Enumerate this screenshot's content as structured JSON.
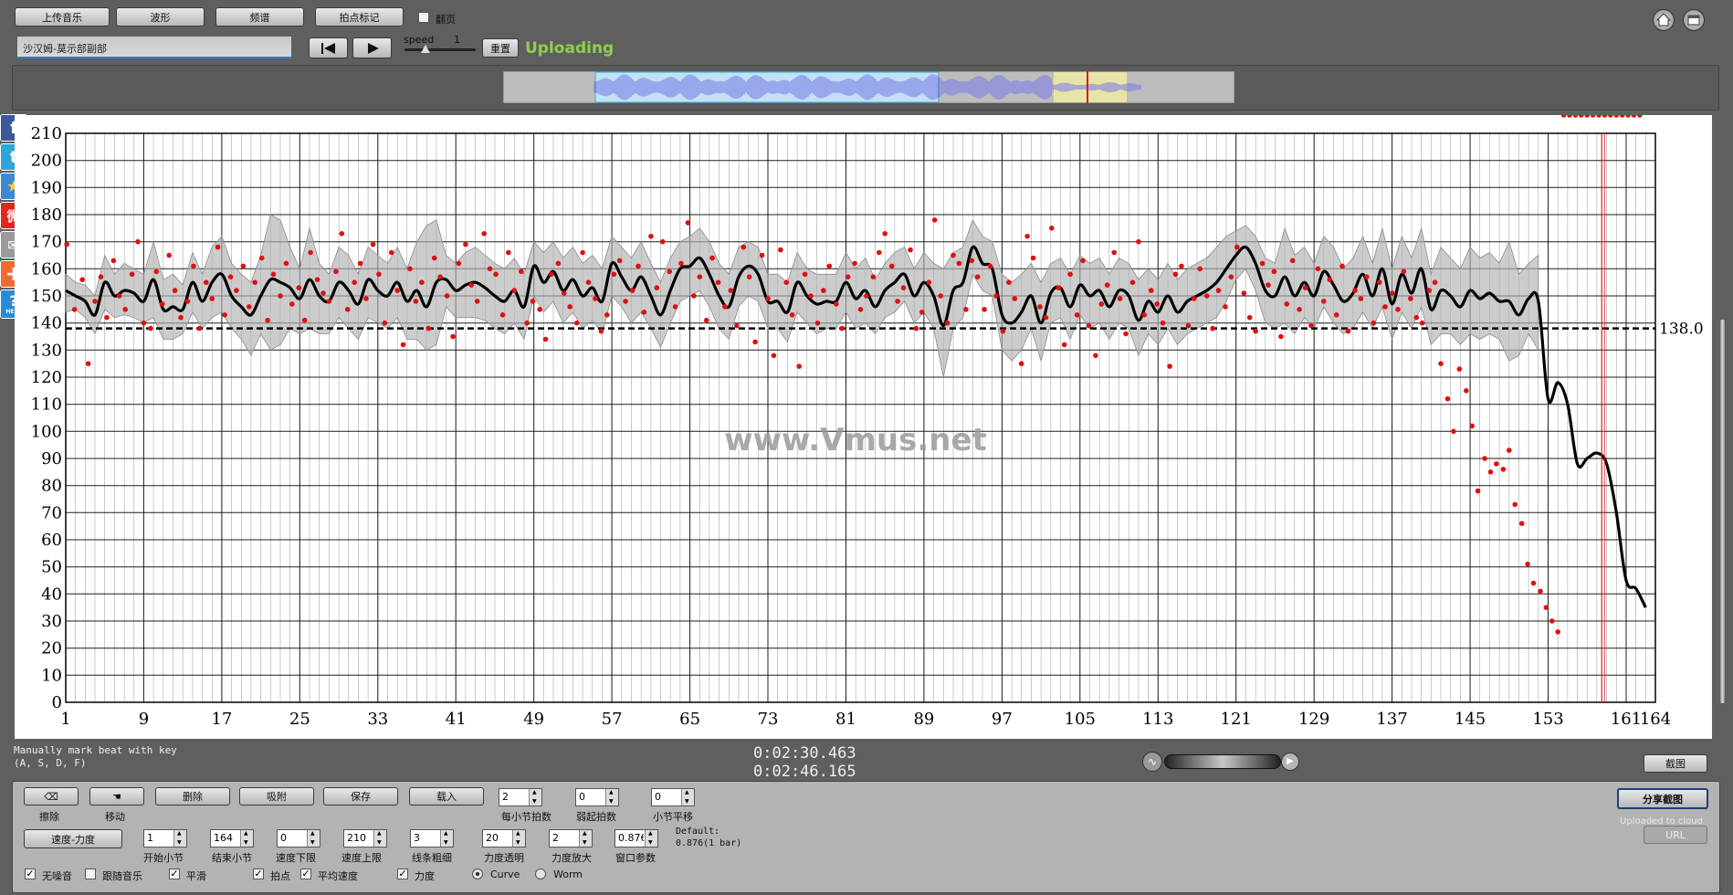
{
  "toolbar": {
    "upload_label": "上传音乐",
    "waveform_label": "波形",
    "spectrum_label": "频谱",
    "beat_label": "拍点标记",
    "flip_label": "翻页",
    "song_title": "沙汉姆-莫示部副部",
    "speed_label": "speed",
    "speed_value": "1",
    "reset_label": "重置",
    "status": "Uploading",
    "status_color": "#8ed04a"
  },
  "icons": [
    "home-icon",
    "window-icon",
    "prev-icon",
    "play-icon",
    "facebook-icon",
    "twitter-icon",
    "star-icon",
    "weibo-icon",
    "mail-icon",
    "plus-icon",
    "help-icon"
  ],
  "social": {
    "help_label": "HELP"
  },
  "watermark": "www.Vmus.net",
  "chart_data": {
    "type": "line",
    "ylim": [
      0,
      210
    ],
    "yticks": [
      0,
      10,
      20,
      30,
      40,
      50,
      60,
      70,
      80,
      90,
      100,
      110,
      120,
      130,
      140,
      150,
      160,
      170,
      180,
      190,
      200,
      210
    ],
    "xlim": [
      1,
      164
    ],
    "xticks": [
      1,
      9,
      17,
      25,
      33,
      41,
      49,
      57,
      65,
      73,
      81,
      89,
      97,
      105,
      113,
      121,
      129,
      137,
      145,
      153,
      161,
      164
    ],
    "reference_line": {
      "value": 138.0,
      "label": "138.0"
    },
    "cursor_bar": 158.5,
    "colors": {
      "smooth_curve": "#000000",
      "beats": "#e01010",
      "band": "#b0b0b0",
      "cursor": "#e02020"
    },
    "smooth_curve": {
      "x": [
        1,
        2,
        3,
        4,
        5,
        6,
        7,
        8,
        9,
        10,
        11,
        12,
        13,
        14,
        15,
        16,
        17,
        18,
        19,
        20,
        21,
        22,
        23,
        24,
        25,
        26,
        27,
        28,
        29,
        30,
        31,
        32,
        33,
        34,
        35,
        36,
        37,
        38,
        39,
        40,
        41,
        42,
        43,
        44,
        45,
        46,
        47,
        48,
        49,
        50,
        51,
        52,
        53,
        54,
        55,
        56,
        57,
        58,
        59,
        60,
        61,
        62,
        63,
        64,
        65,
        66,
        67,
        68,
        69,
        70,
        71,
        72,
        73,
        74,
        75,
        76,
        77,
        78,
        79,
        80,
        81,
        82,
        83,
        84,
        85,
        86,
        87,
        88,
        89,
        90,
        91,
        92,
        93,
        94,
        95,
        96,
        97,
        98,
        99,
        100,
        101,
        102,
        103,
        104,
        105,
        106,
        107,
        108,
        109,
        110,
        111,
        112,
        113,
        114,
        115,
        116,
        117,
        118,
        119,
        120,
        121,
        122,
        123,
        124,
        125,
        126,
        127,
        128,
        129,
        130,
        131,
        132,
        133,
        134,
        135,
        136,
        137,
        138,
        139,
        140,
        141,
        142,
        143,
        144,
        145,
        146,
        147,
        148,
        149,
        150,
        151,
        152,
        153,
        154,
        155,
        156,
        157,
        158,
        159,
        160,
        161,
        162,
        163
      ],
      "y": [
        152,
        150,
        148,
        143,
        155,
        150,
        152,
        151,
        148,
        156,
        145,
        146,
        145,
        155,
        148,
        155,
        158,
        150,
        146,
        143,
        150,
        156,
        155,
        153,
        149,
        156,
        150,
        148,
        155,
        152,
        147,
        156,
        152,
        150,
        155,
        148,
        152,
        146,
        155,
        156,
        152,
        154,
        155,
        153,
        150,
        148,
        152,
        146,
        161,
        155,
        159,
        152,
        156,
        150,
        153,
        148,
        162,
        157,
        152,
        157,
        150,
        143,
        152,
        160,
        161,
        164,
        158,
        150,
        146,
        157,
        161,
        158,
        148,
        148,
        144,
        155,
        150,
        147,
        148,
        148,
        155,
        149,
        152,
        146,
        152,
        155,
        158,
        150,
        155,
        150,
        139,
        152,
        155,
        168,
        162,
        160,
        143,
        140,
        144,
        150,
        140,
        151,
        153,
        146,
        154,
        150,
        152,
        146,
        152,
        150,
        141,
        148,
        144,
        150,
        144,
        148,
        150,
        152,
        155,
        160,
        165,
        168,
        162,
        152,
        150,
        157,
        150,
        155,
        150,
        159,
        154,
        148,
        151,
        158,
        150,
        160,
        147,
        158,
        151,
        160,
        145,
        152,
        150,
        146,
        152,
        149,
        151,
        148,
        148,
        143,
        149,
        148,
        112,
        118,
        110,
        88,
        90,
        92,
        88,
        70,
        45,
        42,
        35,
        25
      ]
    },
    "band": {
      "upper": [
        158,
        155,
        154,
        150,
        165,
        158,
        162,
        160,
        158,
        170,
        156,
        158,
        154,
        166,
        158,
        168,
        172,
        162,
        158,
        155,
        165,
        180,
        178,
        168,
        160,
        175,
        162,
        158,
        168,
        165,
        158,
        168,
        165,
        162,
        168,
        160,
        170,
        176,
        178,
        165,
        162,
        166,
        168,
        165,
        162,
        160,
        164,
        158,
        170,
        166,
        170,
        164,
        168,
        162,
        165,
        160,
        172,
        168,
        164,
        170,
        162,
        155,
        164,
        170,
        172,
        175,
        170,
        162,
        158,
        168,
        170,
        168,
        158,
        158,
        155,
        166,
        160,
        158,
        158,
        158,
        166,
        160,
        164,
        156,
        162,
        166,
        168,
        160,
        166,
        162,
        160,
        166,
        168,
        178,
        172,
        170,
        158,
        155,
        158,
        162,
        155,
        162,
        164,
        158,
        165,
        162,
        164,
        158,
        164,
        162,
        156,
        160,
        156,
        162,
        156,
        160,
        162,
        164,
        168,
        172,
        174,
        176,
        172,
        164,
        162,
        175,
        165,
        168,
        162,
        172,
        168,
        160,
        164,
        172,
        162,
        175,
        160,
        172,
        164,
        175,
        158,
        168,
        164,
        160,
        168,
        164,
        166,
        162,
        170,
        158,
        162,
        165
      ],
      "lower": [
        144,
        145,
        142,
        136,
        145,
        142,
        143,
        142,
        140,
        142,
        134,
        134,
        136,
        144,
        138,
        142,
        144,
        138,
        134,
        128,
        136,
        130,
        132,
        138,
        136,
        138,
        136,
        136,
        142,
        138,
        134,
        142,
        140,
        138,
        142,
        134,
        134,
        130,
        132,
        146,
        142,
        142,
        142,
        141,
        138,
        136,
        140,
        134,
        150,
        144,
        148,
        140,
        144,
        138,
        141,
        136,
        150,
        146,
        140,
        144,
        138,
        131,
        140,
        148,
        150,
        152,
        146,
        138,
        134,
        146,
        150,
        148,
        138,
        138,
        133,
        144,
        140,
        136,
        138,
        138,
        144,
        138,
        140,
        136,
        142,
        144,
        148,
        140,
        144,
        138,
        120,
        138,
        142,
        158,
        152,
        150,
        130,
        126,
        130,
        138,
        126,
        140,
        142,
        134,
        143,
        138,
        140,
        134,
        140,
        138,
        128,
        136,
        132,
        138,
        132,
        136,
        138,
        140,
        142,
        148,
        156,
        160,
        152,
        140,
        138,
        140,
        136,
        142,
        138,
        146,
        140,
        136,
        138,
        144,
        138,
        146,
        134,
        144,
        138,
        146,
        132,
        136,
        136,
        132,
        136,
        134,
        136,
        134,
        126,
        128,
        136,
        130
      ]
    },
    "beats": {
      "x": [
        1.1,
        1.9,
        2.7,
        3.3,
        4,
        4.6,
        5.2,
        5.9,
        6.5,
        7.1,
        7.8,
        8.4,
        9,
        9.7,
        10.3,
        10.9,
        11.6,
        12.2,
        12.8,
        13.5,
        14.1,
        14.7,
        15.4,
        16,
        16.6,
        17.3,
        17.9,
        18.5,
        19.2,
        19.8,
        20.4,
        21.1,
        21.7,
        22.3,
        23,
        23.6,
        24.2,
        24.9,
        25.5,
        26.1,
        26.8,
        27.4,
        28,
        28.7,
        29.3,
        29.9,
        30.6,
        31.2,
        31.8,
        32.5,
        33.1,
        33.7,
        34.4,
        35,
        35.6,
        36.3,
        36.9,
        37.5,
        38.2,
        38.8,
        39.4,
        40.1,
        40.7,
        41.3,
        42,
        42.6,
        43.2,
        43.9,
        44.5,
        45.1,
        45.8,
        46.4,
        47,
        47.7,
        48.3,
        48.9,
        49.6,
        50.2,
        50.8,
        51.5,
        52.1,
        52.7,
        53.4,
        54,
        54.6,
        55.3,
        55.9,
        56.5,
        57.2,
        57.8,
        58.4,
        59.1,
        59.7,
        60.3,
        61,
        61.6,
        62.2,
        62.9,
        63.5,
        64.1,
        64.8,
        65.4,
        66,
        66.7,
        67.3,
        67.9,
        68.6,
        69.2,
        69.8,
        70.5,
        71.1,
        71.7,
        72.4,
        73,
        73.6,
        74.3,
        74.9,
        75.5,
        76.2,
        76.8,
        77.4,
        78.1,
        78.7,
        79.3,
        80,
        80.6,
        81.2,
        81.9,
        82.5,
        83.1,
        83.8,
        84.4,
        85,
        85.7,
        86.3,
        86.9,
        87.6,
        88.2,
        88.8,
        89.5,
        90.1,
        90.7,
        91.4,
        92,
        92.6,
        93.3,
        93.9,
        94.5,
        95.2,
        95.8,
        96.4,
        97.1,
        97.7,
        98.3,
        99,
        99.6,
        100.2,
        100.9,
        101.5,
        102.1,
        102.8,
        103.4,
        104,
        104.7,
        105.3,
        105.9,
        106.6,
        107.2,
        107.8,
        108.5,
        109.1,
        109.7,
        110.4,
        111,
        111.6,
        112.3,
        112.9,
        113.5,
        114.2,
        114.8,
        115.4,
        116.1,
        116.7,
        117.3,
        118,
        118.6,
        119.2,
        119.9,
        120.5,
        121.1,
        121.8,
        122.4,
        123,
        123.7,
        124.3,
        124.9,
        125.6,
        126.2,
        126.8,
        127.5,
        128.1,
        128.7,
        129.4,
        130,
        130.6,
        131.3,
        131.9,
        132.5,
        133.2,
        133.8,
        134.4,
        135.1,
        135.7,
        136.3,
        137,
        137.6,
        138.2,
        138.9,
        139.5,
        140.1,
        140.8,
        141.4,
        142,
        142.7,
        143.3,
        143.9,
        144.6,
        145.2,
        145.8,
        146.5,
        147.1,
        147.7,
        148.4,
        149,
        149.6,
        150.3,
        150.9,
        151.5,
        152.2,
        152.8,
        153.4,
        154,
        154.6,
        155.2,
        155.8,
        156.4,
        157,
        157.6,
        158.2,
        158.8,
        159.4,
        160,
        160.6,
        161.2,
        161.8,
        162.4
      ],
      "y": [
        169,
        145,
        156,
        125,
        148,
        157,
        142,
        163,
        150,
        145,
        158,
        170,
        140,
        138,
        159,
        147,
        165,
        152,
        142,
        148,
        161,
        138,
        155,
        149,
        168,
        143,
        157,
        152,
        161,
        146,
        155,
        164,
        141,
        158,
        150,
        162,
        147,
        153,
        141,
        166,
        156,
        151,
        148,
        159,
        173,
        145,
        155,
        162,
        149,
        169,
        158,
        140,
        166,
        152,
        132,
        160,
        148,
        155,
        138,
        164,
        157,
        150,
        135,
        162,
        169,
        154,
        148,
        173,
        160,
        158,
        143,
        166,
        152,
        159,
        140,
        148,
        145,
        134,
        158,
        162,
        151,
        146,
        140,
        166,
        155,
        149,
        137,
        143,
        158,
        163,
        148,
        152,
        161,
        144,
        172,
        153,
        170,
        159,
        146,
        162,
        177,
        150,
        157,
        141,
        164,
        155,
        146,
        152,
        139,
        168,
        157,
        133,
        165,
        149,
        128,
        167,
        155,
        143,
        124,
        158,
        150,
        140,
        152,
        161,
        147,
        138,
        157,
        162,
        145,
        150,
        157,
        166,
        173,
        161,
        148,
        153,
        167,
        138,
        144,
        155,
        178,
        150,
        140,
        165,
        162,
        145,
        163,
        157,
        145,
        161,
        150,
        137,
        155,
        149,
        125,
        172,
        164,
        146,
        142,
        175,
        153,
        132,
        158,
        143,
        163,
        139,
        128,
        147,
        154,
        166,
        149,
        136,
        155,
        170,
        143,
        152,
        147,
        140,
        124,
        158,
        161,
        139,
        149,
        160,
        150,
        138,
        152,
        146,
        157,
        168,
        151,
        142,
        137,
        162,
        154,
        159,
        135,
        147,
        163,
        145,
        153,
        139,
        160,
        148,
        156,
        143,
        161,
        137,
        152,
        149,
        157,
        140,
        155,
        146,
        151,
        145,
        159,
        149,
        142,
        140,
        152,
        155,
        125,
        112,
        100,
        123,
        115,
        102,
        78,
        90,
        85,
        88,
        86,
        93,
        73,
        66,
        51,
        44,
        41,
        35,
        30,
        26
      ]
    }
  },
  "status_text": {
    "hint_line1": "Manually mark beat with key",
    "hint_line2": "(A, S, D, F)",
    "time_current": "0:02:30.463",
    "time_total": "0:02:46.165",
    "screenshot_label": "截图"
  },
  "controls": {
    "erase_label": "擦除",
    "move_label": "移动",
    "delete_label": "删除",
    "snap_label": "吸附",
    "save_label": "保存",
    "load_label": "载入",
    "beats_per_bar_value": "2",
    "beats_per_bar_label": "每小节拍数",
    "weak_beats_value": "0",
    "weak_beats_label": "弱起拍数",
    "bar_shift_value": "0",
    "bar_shift_label": "小节平移",
    "share_label": "分享截图",
    "uploaded_label": "Uploaded to cloud",
    "url_label": "URL",
    "tempo_force_label": "速度-力度",
    "start_bar_value": "1",
    "start_bar_label": "开始小节",
    "end_bar_value": "164",
    "end_bar_label": "结束小节",
    "tempo_min_value": "0",
    "tempo_min_label": "速度下限",
    "tempo_max_value": "210",
    "tempo_max_label": "速度上限",
    "line_width_value": "3",
    "line_width_label": "线条粗细",
    "force_transparency_value": "20",
    "force_transparency_label": "力度透明",
    "force_scale_value": "2",
    "force_scale_label": "力度放大",
    "window_param_value": "0.876",
    "window_param_label": "窗口参数",
    "default_line1": "Default:",
    "default_line2": "0.876(1 bar)",
    "no_noise_label": "无噪音",
    "follow_music_label": "跟随音乐",
    "smooth_label": "平滑",
    "beat_points_label": "拍点",
    "avg_tempo_label": "平均速度",
    "force_label": "力度",
    "curve_label": "Curve",
    "worm_label": "Worm",
    "checks": {
      "no_noise": true,
      "follow_music": false,
      "smooth": true,
      "beat_points": true,
      "avg_tempo": true,
      "force": true
    },
    "mode": "Curve"
  }
}
